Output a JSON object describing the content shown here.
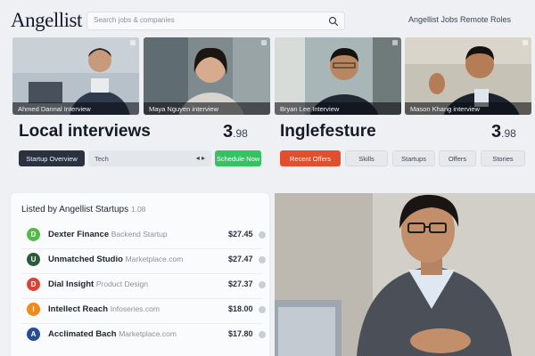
{
  "app": {
    "logo": "Angellist",
    "search_placeholder": "Search jobs & companies",
    "top_right_link": "Angellist Jobs Remote Roles",
    "accent_green": "#34c263",
    "accent_orange": "#e0502e",
    "dark": "#2a3242"
  },
  "videos": [
    {
      "label": "Ahmed Dannal Interview",
      "icon": "expand-icon"
    },
    {
      "label": "Maya Nguyen interview",
      "icon": "expand-icon"
    },
    {
      "label": "Bryan Lee Interview",
      "icon": "expand-icon"
    },
    {
      "label": "Mason Khang interview",
      "icon": "expand-icon"
    }
  ],
  "left_section": {
    "title": "Local interviews",
    "count": "3",
    "count_suffix": ".98",
    "primary_button": "Startup Overview",
    "field_label": "Tech",
    "field_arrows": "◂ ▸",
    "green_button": "Schedule Now"
  },
  "right_section": {
    "title": "Inglefesture",
    "count": "3",
    "count_suffix": ".98",
    "orange_button": "Recent Offers",
    "chips": [
      "Skills",
      "Startups",
      "Offers",
      "Stories"
    ]
  },
  "list_panel": {
    "title": "Listed by Angellist Startups",
    "subtitle": "1.08",
    "rows": [
      {
        "name": "Dexter Finance",
        "meta": "Backend Startup",
        "amount": "$27.45",
        "color": "#55b84a",
        "glyph": "D"
      },
      {
        "name": "Unmatched Studio",
        "meta": "Marketplace.com",
        "amount": "$27.47",
        "color": "#2c5a3a",
        "glyph": "U"
      },
      {
        "name": "Dial Insight",
        "meta": "Product Design",
        "amount": "$27.37",
        "color": "#d6453a",
        "glyph": "D"
      },
      {
        "name": "Intellect Reach",
        "meta": "Infoseries.com",
        "amount": "$18.00",
        "color": "#ee8a24",
        "glyph": "I"
      },
      {
        "name": "Acclimated Bach",
        "meta": "Marketplace.com",
        "amount": "$17.80",
        "color": "#2a4d8f",
        "glyph": "A"
      }
    ]
  }
}
